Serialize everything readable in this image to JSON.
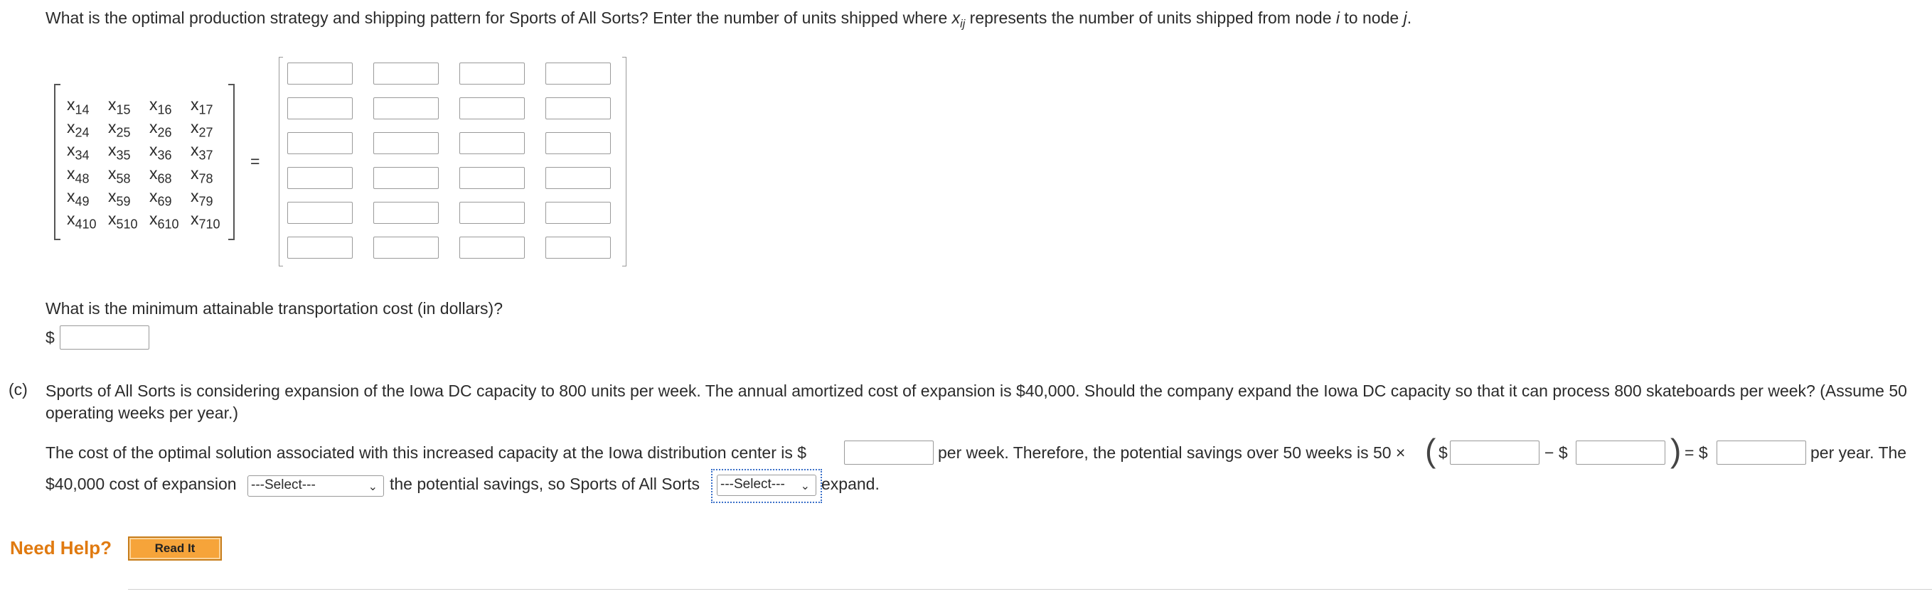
{
  "question": {
    "prefix": "What is the optimal production strategy and shipping pattern for Sports of All Sorts? Enter the number of units shipped where ",
    "var": "x",
    "var_sub": "ij",
    "mid": " represents the number of units shipped from node ",
    "node_i": "i",
    "mid2": " to node ",
    "node_j": "j",
    "suffix": "."
  },
  "variable_matrix": [
    [
      "14",
      "15",
      "16",
      "17"
    ],
    [
      "24",
      "25",
      "26",
      "27"
    ],
    [
      "34",
      "35",
      "36",
      "37"
    ],
    [
      "48",
      "58",
      "68",
      "78"
    ],
    [
      "49",
      "59",
      "69",
      "79"
    ],
    [
      "410",
      "510",
      "610",
      "710"
    ]
  ],
  "var_symbol": "x",
  "equals": "=",
  "min_cost": {
    "question": "What is the minimum attainable transportation cost (in dollars)?",
    "dollar": "$",
    "value": ""
  },
  "part_c": {
    "label": "(c)",
    "text": "Sports of All Sorts is considering expansion of the Iowa DC capacity to 800 units per week. The annual amortized cost of expansion is $40,000. Should the company expand the Iowa DC capacity so that it can process 800 skateboards per week? (Assume 50 operating weeks per year.)",
    "line3_a": "The cost of the optimal solution associated with this increased capacity at the Iowa distribution center is $",
    "line3_b": "per week. Therefore, the potential savings over 50 weeks is 50 ×",
    "paren_l": "(",
    "dollar": "$",
    "minus": "− $",
    "paren_r": ")",
    "equals_dollar": "= $",
    "line3_c": "per year. The",
    "line4_a": "$40,000 cost of expansion",
    "line4_b": "the potential savings, so Sports of All Sorts",
    "line4_c": "expand.",
    "select1": "---Select---",
    "select2": "---Select---"
  },
  "help": {
    "label": "Need Help?",
    "button": "Read It"
  },
  "colors": {
    "help": "#e07a10",
    "button": "#f6a43a",
    "focus": "#3a70c9"
  }
}
